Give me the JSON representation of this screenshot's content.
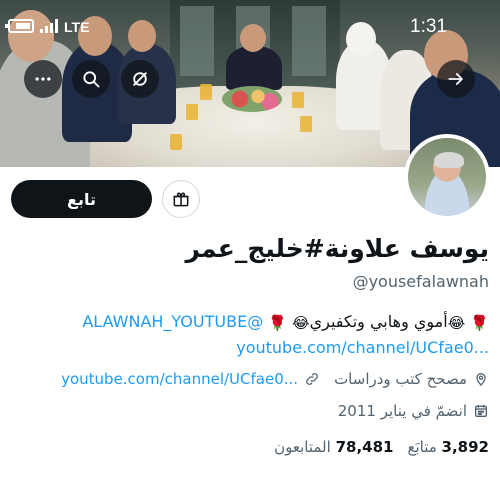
{
  "status_bar": {
    "time": "1:31",
    "network": "LTE"
  },
  "banner": {
    "buttons": [
      {
        "name": "more-button",
        "icon": "more-icon"
      },
      {
        "name": "search-button",
        "icon": "search-icon"
      },
      {
        "name": "mute-button",
        "icon": "no-notification-icon"
      },
      {
        "name": "back-button",
        "icon": "arrow-right-icon"
      }
    ]
  },
  "profile": {
    "follow_label": "تابع",
    "display_name": "يوسف علاونة#خليج_عمر",
    "handle": "@yousefalawnah",
    "bio_line1_text": "أموي وهابي وتكفيري",
    "bio_line1_link": "@ALAWNAH_YOUTUBE",
    "bio_line2_link": "youtube.com/channel/UCfae0...",
    "location": "مصحح كتب ودراسات",
    "website": "youtube.com/channel/UCfae0...",
    "joined": "انضمّ في يناير 2011",
    "following_count": "3,892",
    "following_label": "متابَع",
    "followers_count": "78,481",
    "followers_label": "المتابعون"
  },
  "colors": {
    "accent": "#1d9bf0",
    "text": "#0f1419",
    "muted": "#536471",
    "button": "#0f1419"
  },
  "icons": [
    "gift-icon",
    "location-icon",
    "link-icon",
    "calendar-icon",
    "rose-emoji",
    "laughing-emoji"
  ]
}
